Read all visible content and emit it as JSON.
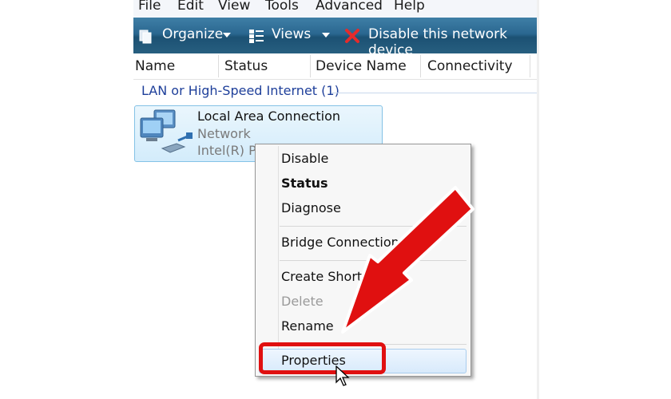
{
  "menubar": {
    "items": [
      "File",
      "Edit",
      "View",
      "Tools",
      "Advanced",
      "Help"
    ]
  },
  "toolbar": {
    "organize": "Organize",
    "views": "Views",
    "disable_device": "Disable this network device"
  },
  "columns": [
    "Name",
    "Status",
    "Device Name",
    "Connectivity"
  ],
  "group": {
    "title": "LAN or High-Speed Internet (1)"
  },
  "connection": {
    "name": "Local Area Connection",
    "status": "Network",
    "device": "Intel(R) PR"
  },
  "context_menu": {
    "items": [
      {
        "label": "Disable",
        "style": "normal"
      },
      {
        "label": "Status",
        "style": "bold"
      },
      {
        "label": "Diagnose",
        "style": "normal"
      },
      {
        "label": "Bridge Connections",
        "style": "normal"
      },
      {
        "label": "Create Shortcut",
        "style": "normal"
      },
      {
        "label": "Delete",
        "style": "disabled"
      },
      {
        "label": "Rename",
        "style": "normal"
      },
      {
        "label": "Properties",
        "style": "highlighted"
      }
    ]
  },
  "colors": {
    "toolbar": "#2a6790",
    "group_text": "#1e3f9a",
    "annotation": "#e01010",
    "selection": "#d8eafb"
  },
  "icons": [
    "organize-icon",
    "views-icon",
    "disable-x-icon",
    "network-connection-icon",
    "mouse-pointer-icon"
  ]
}
